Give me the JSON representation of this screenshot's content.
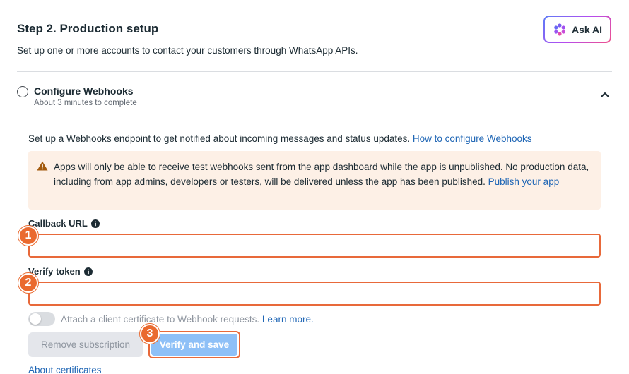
{
  "header": {
    "title": "Step 2. Production setup",
    "subtitle": "Set up one or more accounts to contact your customers through WhatsApp APIs.",
    "ask_ai_label": "Ask AI",
    "ask_ai_icon": "sparkle-flower-icon"
  },
  "step": {
    "title": "Configure Webhooks",
    "meta": "About 3 minutes to complete",
    "expanded": true
  },
  "content": {
    "intro_text": "Set up a Webhooks endpoint to get notified about incoming messages and status updates.",
    "intro_link": "How to configure Webhooks",
    "warning_text": "Apps will only be able to receive test webhooks sent from the app dashboard while the app is unpublished. No production data, including from app admins, developers or testers, will be delivered unless the app has been published.",
    "warning_link": "Publish your app"
  },
  "form": {
    "callback_label": "Callback URL",
    "callback_value": "",
    "verify_label": "Verify token",
    "verify_value": "",
    "cert_toggle_label": "Attach a client certificate to Webhook requests.",
    "cert_toggle_on": false,
    "learn_more": "Learn more.",
    "remove_button": "Remove subscription",
    "verify_button": "Verify and save",
    "about_link": "About certificates"
  },
  "annotations": {
    "badge_1": "1",
    "badge_2": "2",
    "badge_3": "3"
  },
  "colors": {
    "accent_link": "#1f66b5",
    "highlight": "#e8693a",
    "warning_bg": "#fdf0e6",
    "primary_disabled": "#8ec0f7"
  }
}
